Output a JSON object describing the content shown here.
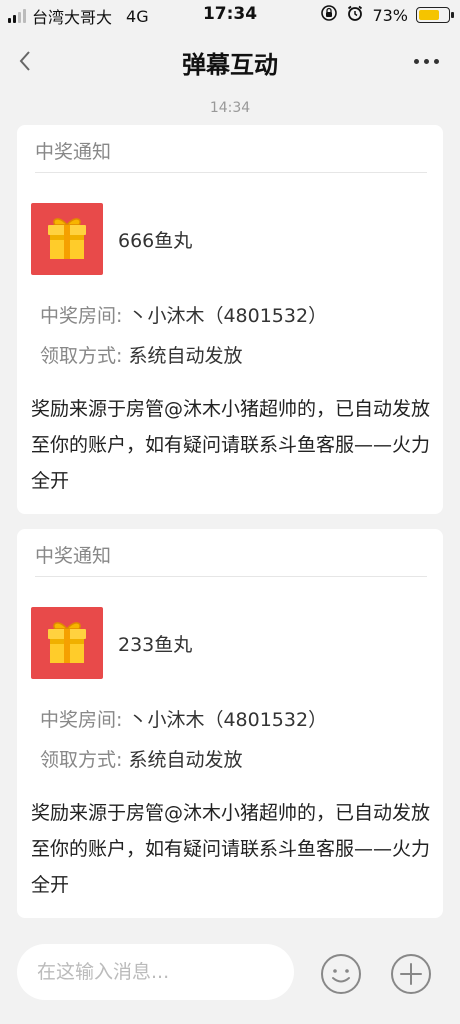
{
  "status_bar": {
    "carrier": "台湾大哥大",
    "network": "4G",
    "time": "17:34",
    "battery": "73%",
    "battery_level": 0.73,
    "battery_color": "#f5c400"
  },
  "nav": {
    "title": "弹幕互动",
    "back_icon": "chevron-left-icon",
    "more_icon": "more-dots-icon"
  },
  "timestamp": "14:34",
  "cards": [
    {
      "header": "中奖通知",
      "prize": "666鱼丸",
      "room_label": "中奖房间:",
      "room_value": "丶小沐木（4801532）",
      "method_label": "领取方式:",
      "method_value": "系统自动发放",
      "description": "奖励来源于房管@沐木小猪超帅的，已自动发放至你的账户，如有疑问请联系斗鱼客服——火力全开"
    },
    {
      "header": "中奖通知",
      "prize": "233鱼丸",
      "room_label": "中奖房间:",
      "room_value": "丶小沐木（4801532）",
      "method_label": "领取方式:",
      "method_value": "系统自动发放",
      "description": "奖励来源于房管@沐木小猪超帅的，已自动发放至你的账户，如有疑问请联系斗鱼客服——火力全开"
    }
  ],
  "input": {
    "placeholder": "在这输入消息..."
  },
  "colors": {
    "accent": "#f5c400",
    "gift_bg": "#e84a4a",
    "page_bg": "#f2f2f2"
  }
}
